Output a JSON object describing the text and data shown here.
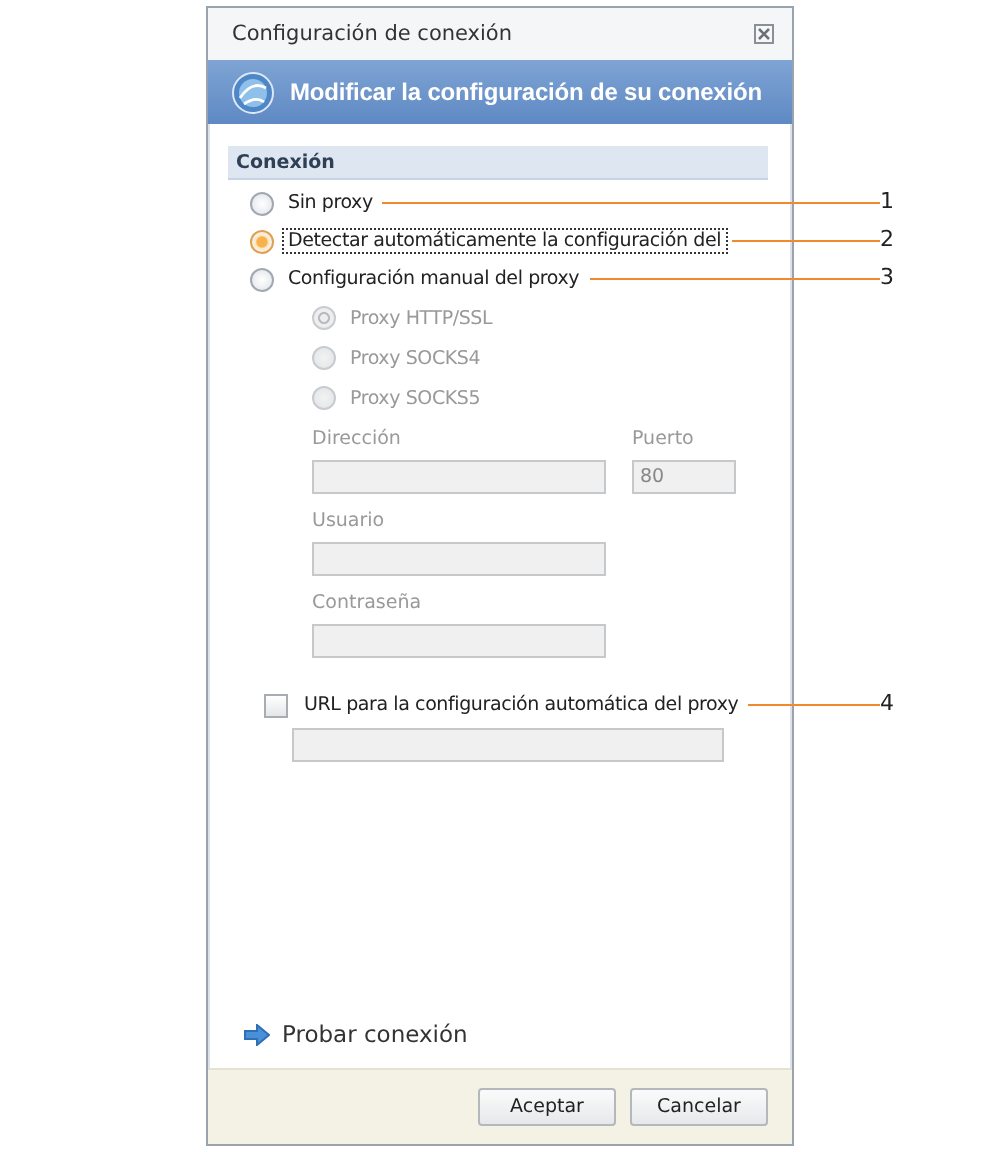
{
  "window": {
    "title": "Configuración de conexión"
  },
  "header": {
    "title": "Modificar la configuración de su conexión"
  },
  "section": {
    "title": "Conexión"
  },
  "proxy_modes": [
    {
      "label": "Sin proxy",
      "selected": false,
      "focused": false,
      "callout": "1"
    },
    {
      "label": "Detectar automáticamente la configuración del",
      "selected": true,
      "focused": true,
      "callout": "2"
    },
    {
      "label": "Configuración manual del proxy",
      "selected": false,
      "focused": false,
      "callout": "3"
    }
  ],
  "proxy_types": [
    {
      "label": "Proxy HTTP/SSL",
      "selected": true,
      "disabled": true
    },
    {
      "label": "Proxy SOCKS4",
      "selected": false,
      "disabled": true
    },
    {
      "label": "Proxy SOCKS5",
      "selected": false,
      "disabled": true
    }
  ],
  "address": {
    "label": "Dirección",
    "disabled": true
  },
  "port": {
    "label": "Puerto",
    "value": "80",
    "disabled": true
  },
  "user": {
    "label": "Usuario",
    "disabled": true
  },
  "password": {
    "label": "Contraseña",
    "disabled": true
  },
  "auto_config_url": {
    "label": "URL para la configuración automática del proxy",
    "checked": false,
    "callout": "4"
  },
  "test_link": "Probar conexión",
  "buttons": [
    "Aceptar",
    "Cancelar"
  ]
}
